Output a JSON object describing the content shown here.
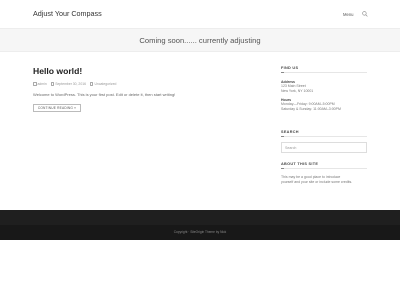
{
  "header": {
    "site_title": "Adjust Your Compass",
    "nav_menu": "Menu"
  },
  "hero": {
    "title": "Coming soon...... currently adjusting"
  },
  "post": {
    "title": "Hello world!",
    "meta": {
      "author": "admin",
      "date": "September 30, 2016",
      "category": "Uncategorized"
    },
    "excerpt": "Welcome to WordPress. This is your first post. Edit or delete it, then start writing!",
    "read_more": "CONTINUE READING »"
  },
  "sidebar": {
    "find_us": {
      "title": "FIND US",
      "address_label": "Address",
      "address_lines": [
        "123 Main Street",
        "New York, NY 10001"
      ],
      "hours_label": "Hours",
      "hours_lines": [
        "Monday—Friday: 9:00AM–5:00PM",
        "Saturday & Sunday: 11:00AM–3:00PM"
      ]
    },
    "search": {
      "title": "SEARCH",
      "placeholder": "Search"
    },
    "about": {
      "title": "ABOUT THIS SITE",
      "lines": [
        "This may be a good place to introduce",
        "yourself and your site or include some credits."
      ]
    }
  },
  "footer": {
    "text": "Copyright · SiteOrigin Theme by Nick"
  },
  "colors": {
    "footer_bg": "#1f1f1f",
    "hero_bg": "#f6f6f6"
  }
}
